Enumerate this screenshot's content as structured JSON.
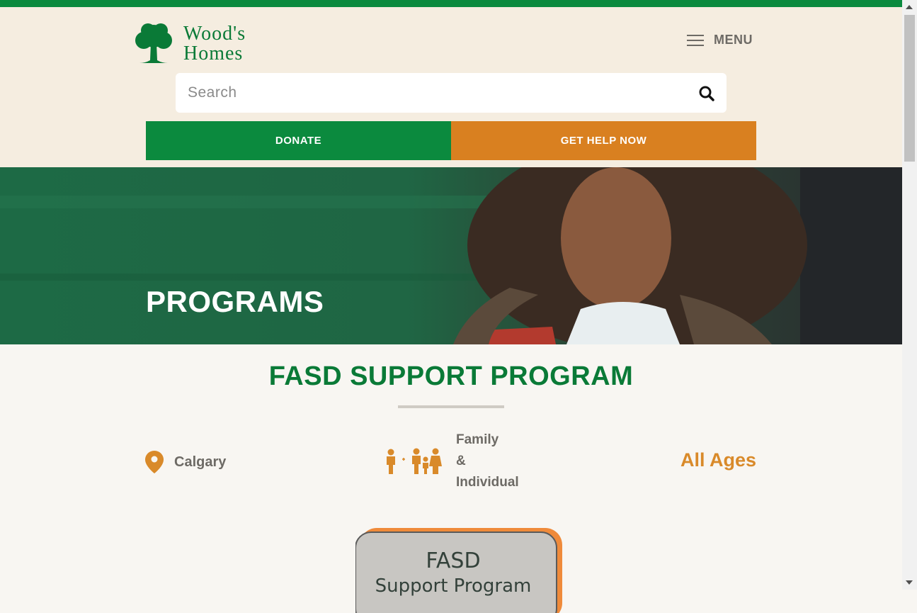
{
  "brand": {
    "line1": "Wood's",
    "line2": "Homes",
    "color": "#0a7a37"
  },
  "menu": {
    "label": "MENU",
    "icon": "hamburger-icon"
  },
  "search": {
    "placeholder": "Search",
    "icon": "search-icon"
  },
  "actions": {
    "donate": "DONATE",
    "get_help": "GET HELP NOW",
    "donate_color": "#0b8a3e",
    "help_color": "#d98020"
  },
  "hero": {
    "title": "PROGRAMS"
  },
  "program": {
    "title": "FASD SUPPORT PROGRAM",
    "location": "Calgary",
    "audience_lines": [
      "Family",
      "&",
      "Individual"
    ],
    "ages": "All Ages",
    "image_text_line1": "FASD",
    "image_text_line2": "Support Program"
  }
}
